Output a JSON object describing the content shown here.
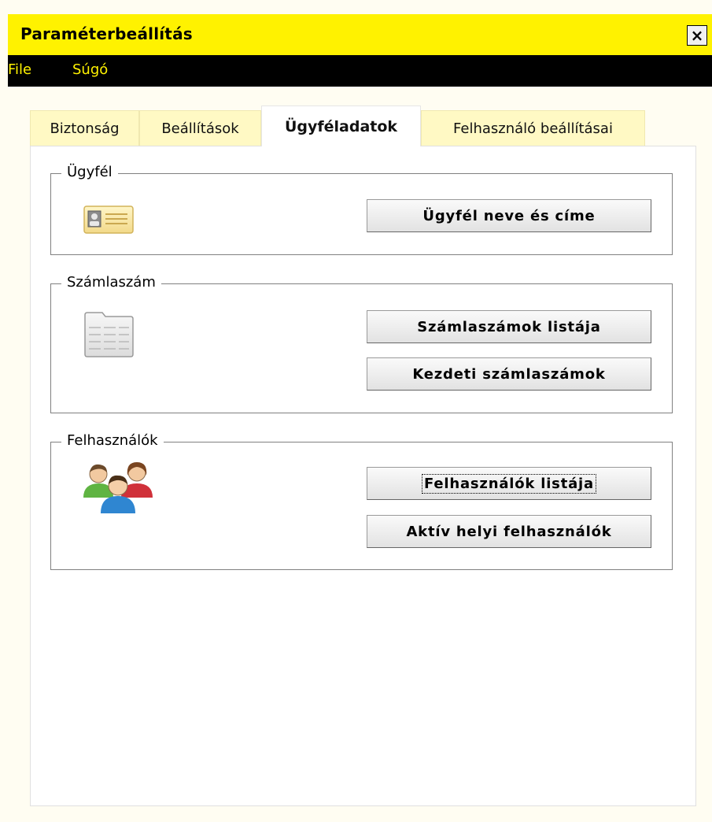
{
  "window": {
    "title": "Paraméterbeállítás",
    "close_label": "×"
  },
  "menu": {
    "items": [
      "File",
      "Súgó"
    ]
  },
  "tabs": [
    {
      "label": "Biztonság",
      "active": false
    },
    {
      "label": "Beállítások",
      "active": false
    },
    {
      "label": "Ügyféladatok",
      "active": true
    },
    {
      "label": "Felhasználó beállításai",
      "active": false
    }
  ],
  "groups": {
    "client": {
      "legend": "Ügyfél",
      "icon": "id-card-icon",
      "buttons": [
        "Ügyfél neve és címe"
      ]
    },
    "invoice": {
      "legend": "Számlaszám",
      "icon": "invoice-list-icon",
      "buttons": [
        "Számlaszámok listája",
        "Kezdeti számlaszámok"
      ]
    },
    "users": {
      "legend": "Felhasználók",
      "icon": "users-group-icon",
      "buttons": [
        "Felhasználók listája",
        "Aktív helyi felhasználók"
      ]
    }
  },
  "colors": {
    "title_bar": "#fff200",
    "menu_bar": "#000000",
    "menu_text": "#fff200",
    "inactive_tab": "#fff9c4"
  }
}
